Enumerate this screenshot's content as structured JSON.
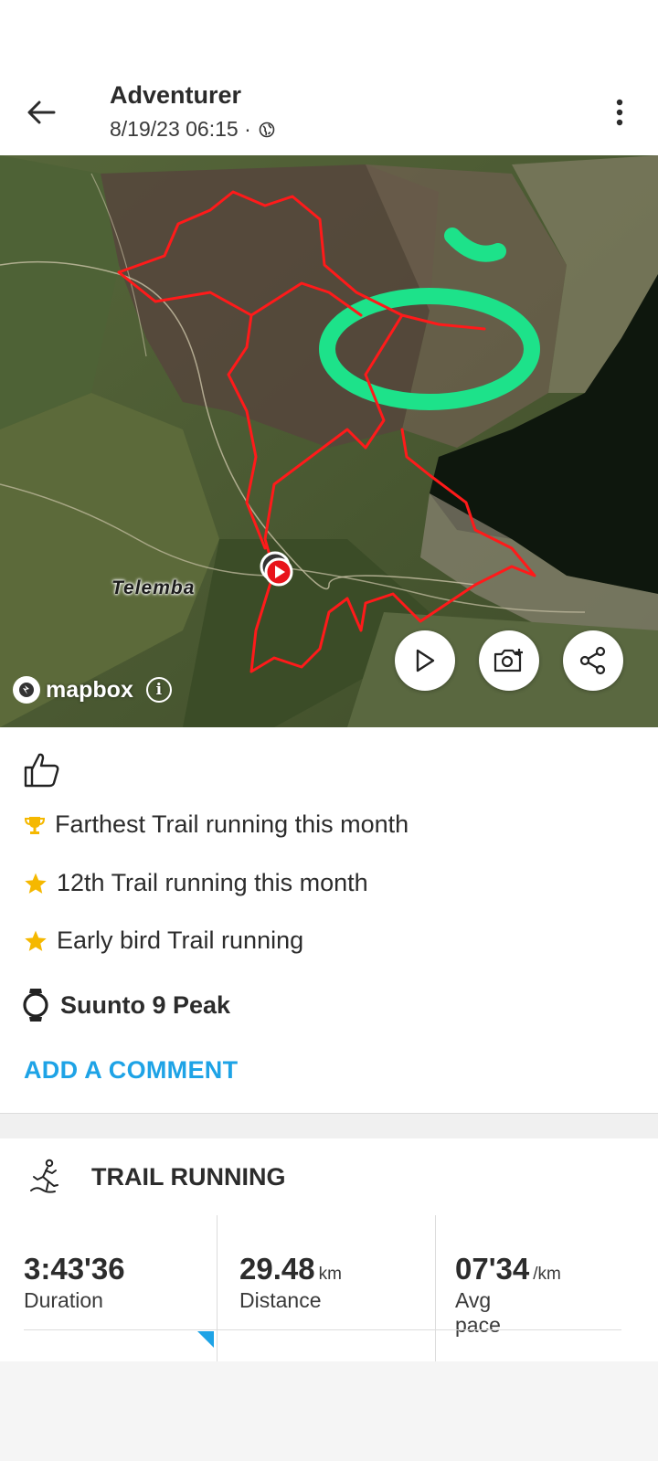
{
  "header": {
    "title": "Adventurer",
    "datetime": "8/19/23 06:15 ·",
    "back_icon": "back-arrow-icon",
    "more_icon": "more-vertical-icon",
    "visibility_icon": "globe-icon"
  },
  "map": {
    "place_label": "Telemba",
    "attribution": "mapbox",
    "route_color": "#ff1a1a",
    "highlight_color": "#1de28a",
    "buttons": [
      "play-icon",
      "add-photo-icon",
      "share-icon"
    ]
  },
  "achievements": [
    {
      "icon": "trophy-icon",
      "text": "Farthest Trail running this month"
    },
    {
      "icon": "star-icon",
      "text": "12th Trail running this month"
    },
    {
      "icon": "star-icon",
      "text": "Early bird Trail running"
    }
  ],
  "device": {
    "name": "Suunto 9 Peak"
  },
  "comment": {
    "label": "ADD A COMMENT"
  },
  "activity": {
    "type": "TRAIL RUNNING"
  },
  "stats": [
    {
      "value": "3:43'36",
      "unit": "",
      "label": "Duration"
    },
    {
      "value": "29.48",
      "unit": "km",
      "label": "Distance"
    },
    {
      "value": "07'34",
      "unit": "/km",
      "label": "Avg pace"
    }
  ],
  "colors": {
    "accent": "#1ea3e6",
    "star": "#f5b800"
  }
}
